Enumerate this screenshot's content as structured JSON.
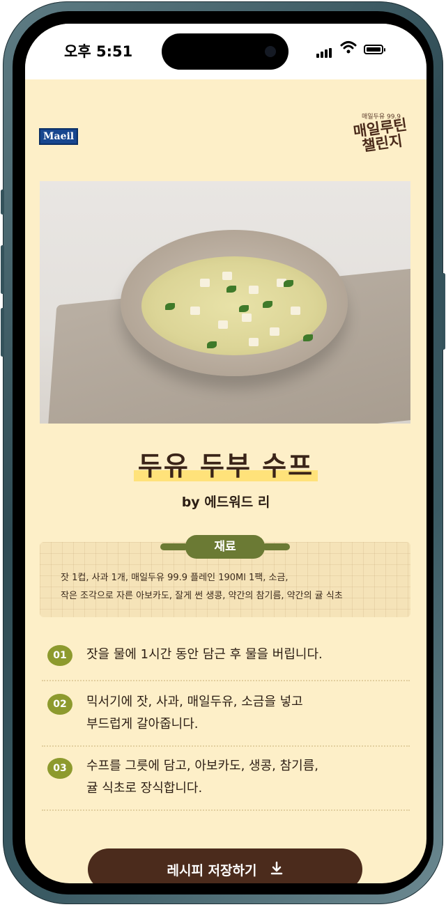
{
  "status_bar": {
    "time": "오후 5:51"
  },
  "logos": {
    "brand": "Maeil",
    "challenge_small": "매일두유 99.9",
    "challenge_main": "매일루틴 챌린지"
  },
  "recipe": {
    "title": "두유 두부 수프",
    "author": "by 에드워드 리",
    "ingredients_label": "재료",
    "ingredients_line1": "잣 1컵, 사과 1개, 매일두유 99.9 플레인 190Ml 1팩, 소금,",
    "ingredients_line2": "작은 조각으로 자른 아보카도, 잘게 썬 생콩, 약간의 참기름, 약간의 귤 식초",
    "steps": [
      {
        "num": "01",
        "line1": "잣을 물에 1시간 동안 담근 후 물을 버립니다.",
        "line2": ""
      },
      {
        "num": "02",
        "line1": "믹서기에 잣, 사과, 매일두유, 소금을 넣고",
        "line2": "부드럽게 갈아줍니다."
      },
      {
        "num": "03",
        "line1": "수프를 그릇에 담고, 아보카도, 생콩, 참기름,",
        "line2": "귤 식초로 장식합니다."
      }
    ]
  },
  "actions": {
    "save_label": "레시피 저장하기",
    "save_icon": "download-icon"
  },
  "colors": {
    "background": "#fdefc8",
    "accent_dark": "#4b2b1c",
    "accent_olive": "#8d9a2e",
    "highlight": "#ffe27a"
  }
}
